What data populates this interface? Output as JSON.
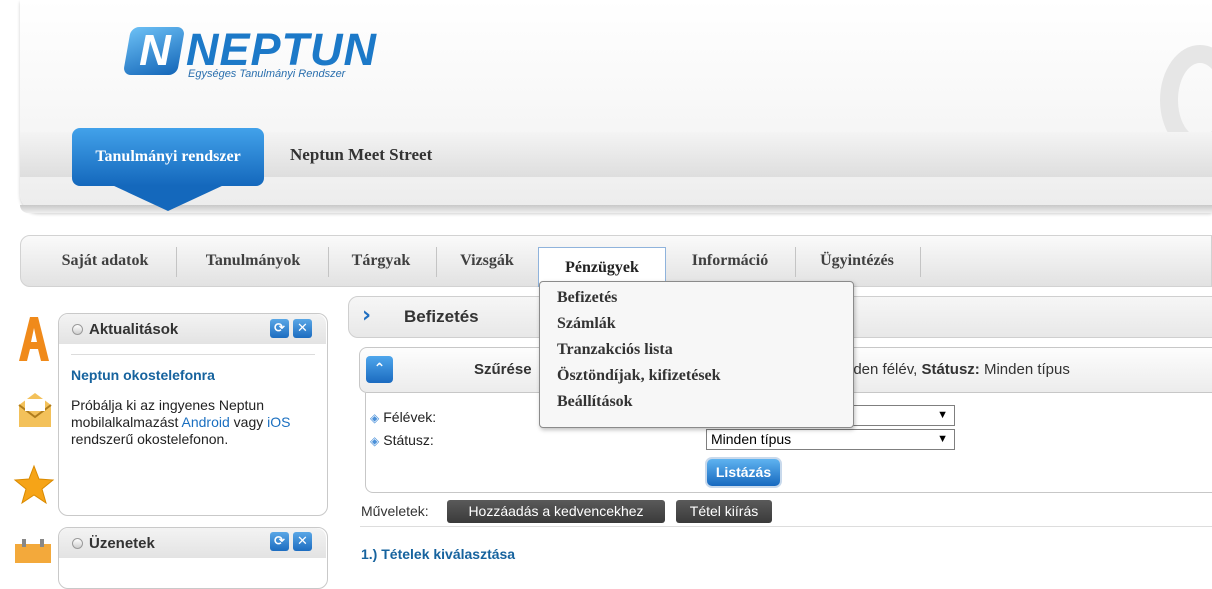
{
  "logo": {
    "word": "NEPTUN",
    "letter": "N",
    "subtitle": "Egységes Tanulmányi Rendszer"
  },
  "header_tabs": {
    "active": "Tanulmányi rendszer",
    "other": "Neptun Meet Street"
  },
  "main_menu": [
    "Saját adatok",
    "Tanulmányok",
    "Tárgyak",
    "Vizsgák",
    "Pénzügyek",
    "Információ",
    "Ügyintézés"
  ],
  "finance_dropdown": [
    "Befizetés",
    "Számlák",
    "Tranzakciós lista",
    "Ösztöndíjak, kifizetések",
    "Beállítások"
  ],
  "news_panel": {
    "title": "Aktualitások",
    "item_title": "Neptun okostelefonra",
    "text_1": "Próbálja ki az ingyenes Neptun mobilalkalmazást ",
    "link_android": "Android",
    "text_2": " vagy ",
    "link_ios": "iOS",
    "text_3": " rendszerű okostelefonon."
  },
  "messages_panel": {
    "title": "Üzenetek"
  },
  "page": {
    "title": "Befizetés"
  },
  "filter": {
    "label": "Szűrése",
    "summary_prefix": "nden félév, ",
    "summary_status_label": "Státusz:",
    "summary_status_value": " Minden típus",
    "semesters_label": "Félévek:",
    "status_label": "Státusz:",
    "semesters_value": "",
    "status_value": "Minden típus",
    "list_button": "Listázás"
  },
  "operations": {
    "label": "Műveletek:",
    "add_favorite": "Hozzáadás a kedvencekhez",
    "item_export": "Tétel kiírás"
  },
  "step1": "1.) Tételek kiválasztása"
}
